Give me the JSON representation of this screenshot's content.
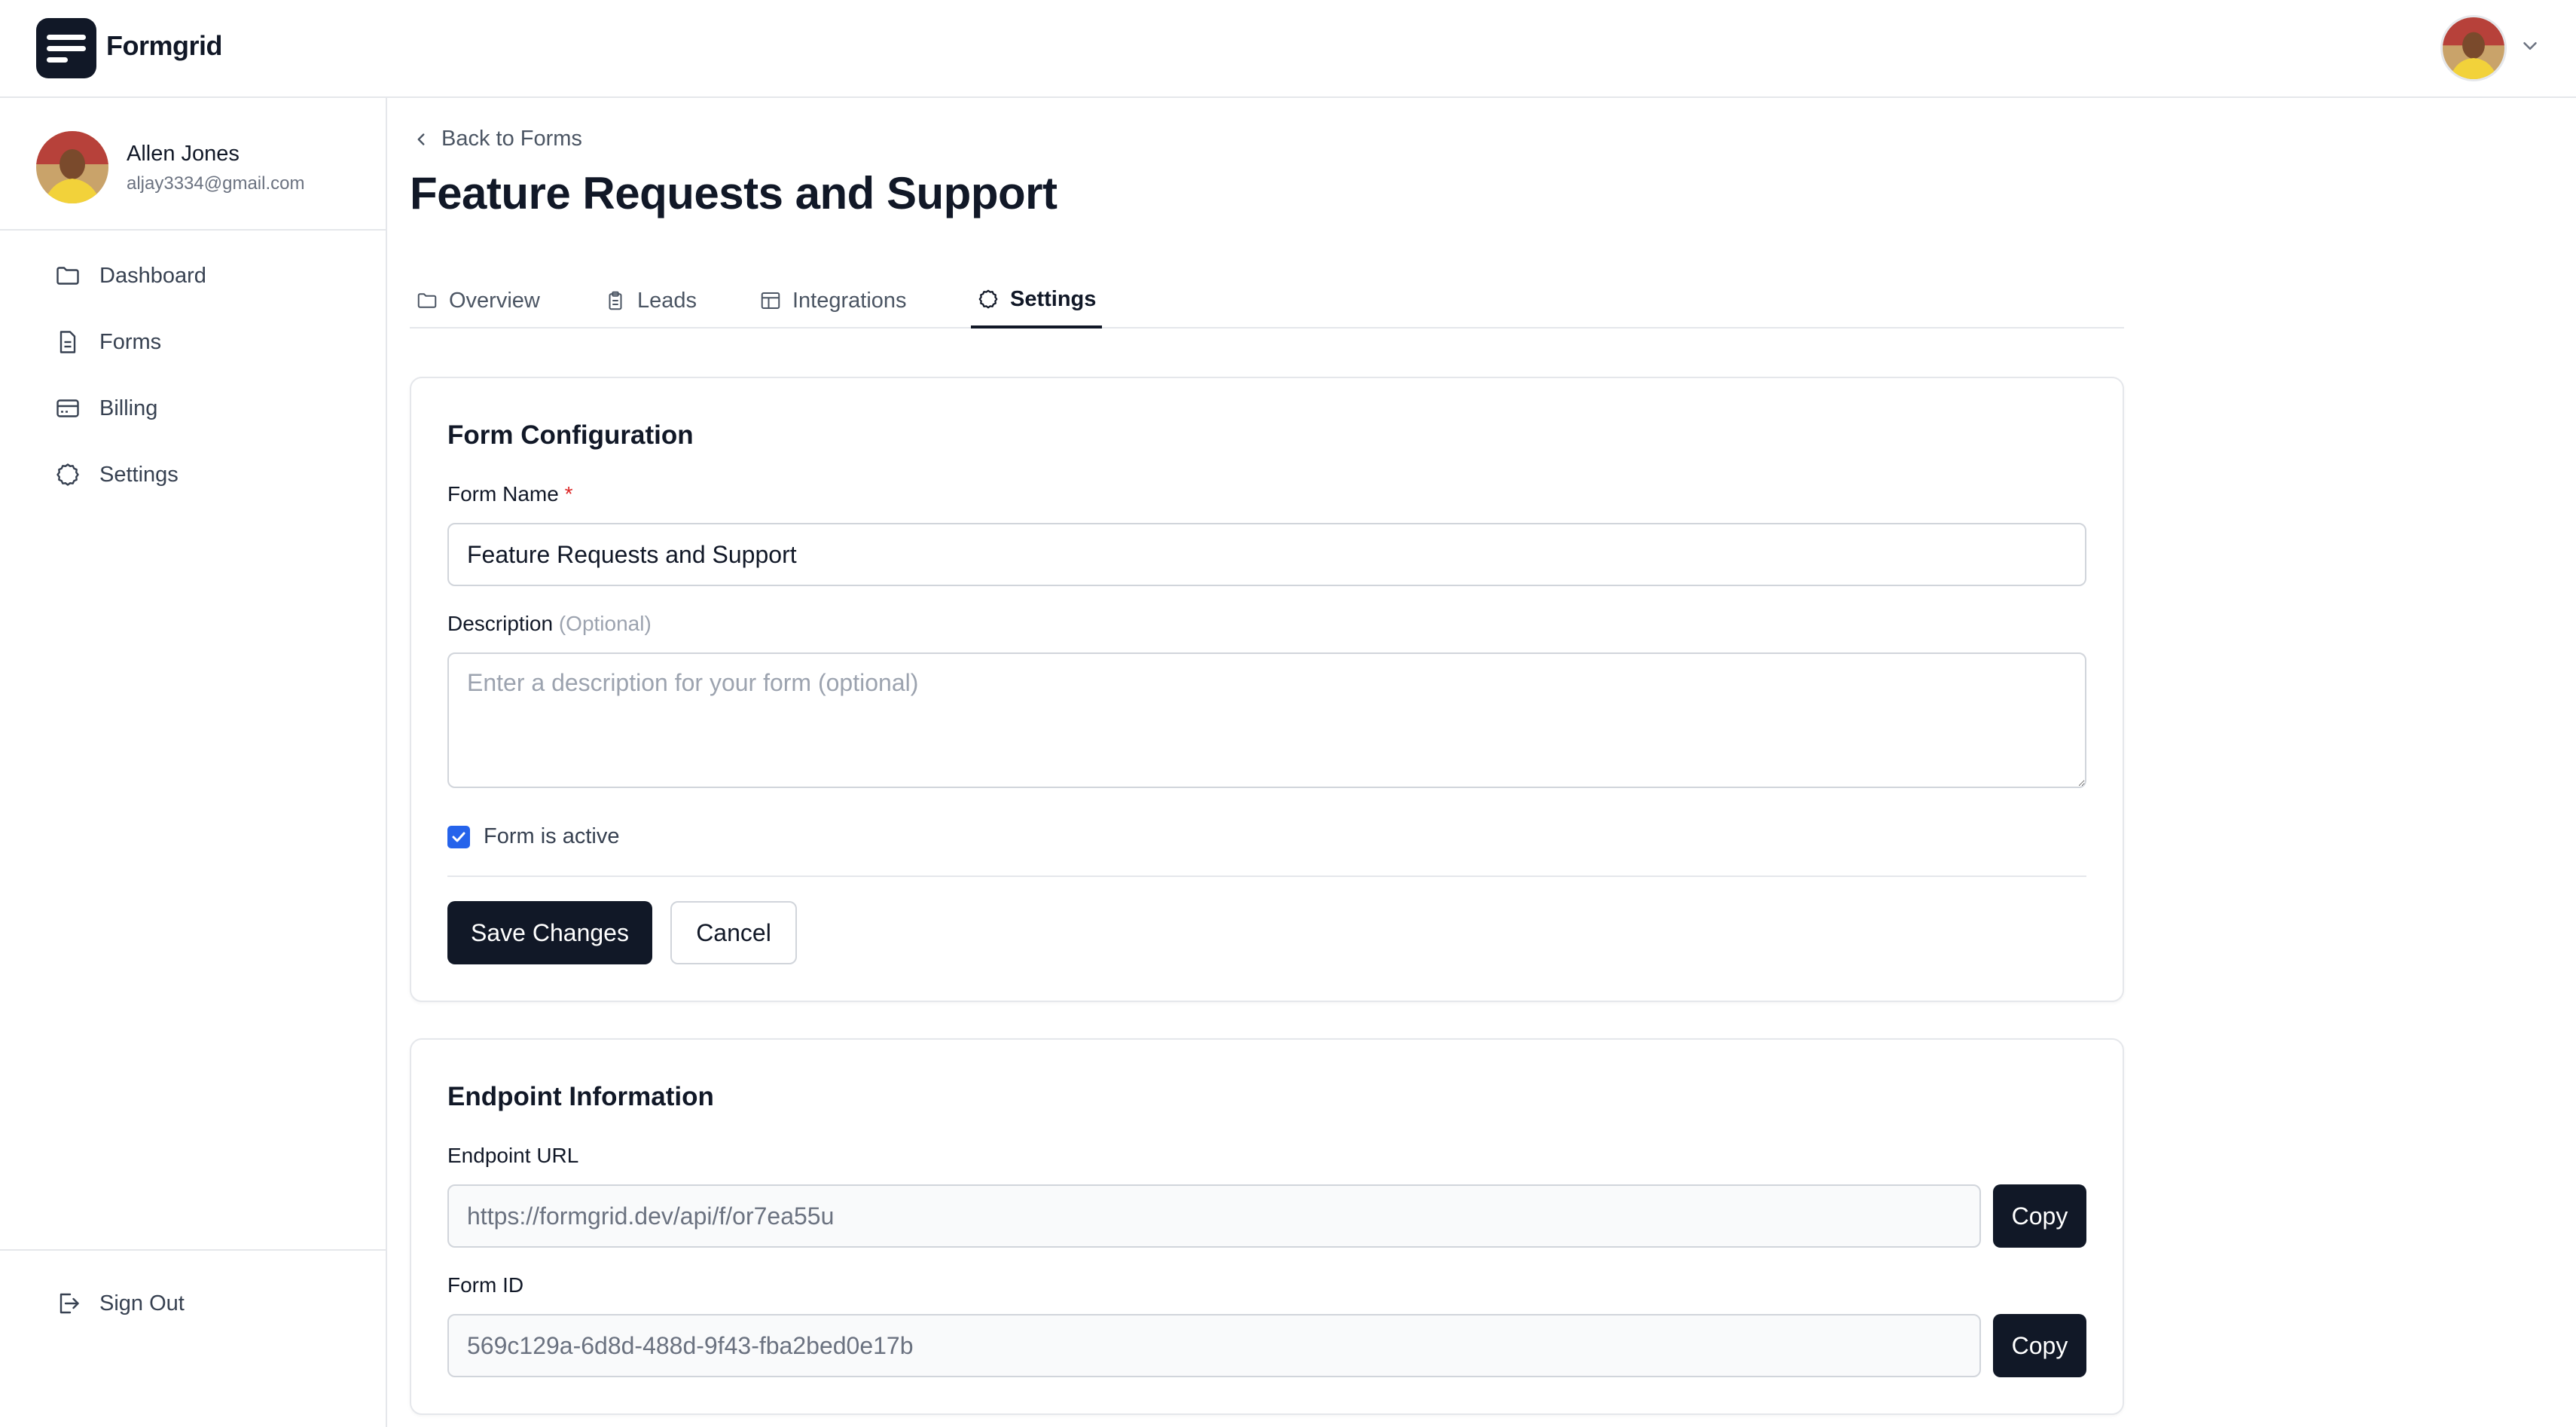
{
  "app": {
    "brand": "Formgrid",
    "icons": {
      "logo": "menu-lines-icon",
      "account_menu": "chevron-down-icon"
    }
  },
  "user": {
    "name": "Allen Jones",
    "email": "aljay3334@gmail.com"
  },
  "sidebar": {
    "items": [
      {
        "label": "Dashboard",
        "icon": "folder-icon"
      },
      {
        "label": "Forms",
        "icon": "document-icon"
      },
      {
        "label": "Billing",
        "icon": "credit-card-icon"
      },
      {
        "label": "Settings",
        "icon": "gear-icon"
      }
    ],
    "signout": {
      "label": "Sign Out",
      "icon": "sign-out-icon"
    }
  },
  "page": {
    "back_label": "Back to Forms",
    "title": "Feature Requests and Support"
  },
  "tabs": [
    {
      "label": "Overview",
      "icon": "folder-icon",
      "active": false
    },
    {
      "label": "Leads",
      "icon": "clipboard-icon",
      "active": false
    },
    {
      "label": "Integrations",
      "icon": "layout-icon",
      "active": false
    },
    {
      "label": "Settings",
      "icon": "gear-icon",
      "active": true
    }
  ],
  "form_config": {
    "title": "Form Configuration",
    "name_label": "Form Name",
    "required_mark": "*",
    "name_value": "Feature Requests and Support",
    "description_label": "Description",
    "description_optional": "(Optional)",
    "description_placeholder": "Enter a description for your form (optional)",
    "description_value": "",
    "active_label": "Form is active",
    "active_checked": true,
    "save_label": "Save Changes",
    "cancel_label": "Cancel"
  },
  "endpoint": {
    "title": "Endpoint Information",
    "url_label": "Endpoint URL",
    "url_value": "https://formgrid.dev/api/f/or7ea55u",
    "form_id_label": "Form ID",
    "form_id_value": "569c129a-6d8d-488d-9f43-fba2bed0e17b",
    "copy_label": "Copy"
  },
  "colors": {
    "primary": "#111827",
    "accent_checkbox": "#2563eb",
    "required": "#dc2626",
    "border": "#e5e7eb",
    "muted_text": "#6b7280"
  }
}
